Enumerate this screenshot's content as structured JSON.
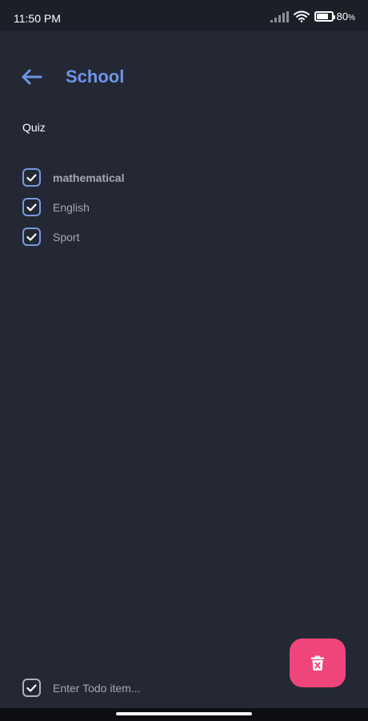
{
  "status_bar": {
    "time": "11:50 PM",
    "battery_percent": "80",
    "battery_unit": "%",
    "battery_level": 0.8
  },
  "header": {
    "title": "School",
    "back_icon": "arrow-left-icon"
  },
  "section": {
    "label": "Quiz"
  },
  "todos": [
    {
      "label": "mathematical",
      "checked": true
    },
    {
      "label": "English",
      "checked": true
    },
    {
      "label": "Sport",
      "checked": true
    }
  ],
  "input": {
    "placeholder": "Enter Todo item...",
    "value": ""
  },
  "fab": {
    "icon": "trash-x-icon"
  },
  "colors": {
    "background": "#232834",
    "accent": "#6f95e8",
    "fab": "#f0457a",
    "checkbox_border": "#7c97dd"
  }
}
